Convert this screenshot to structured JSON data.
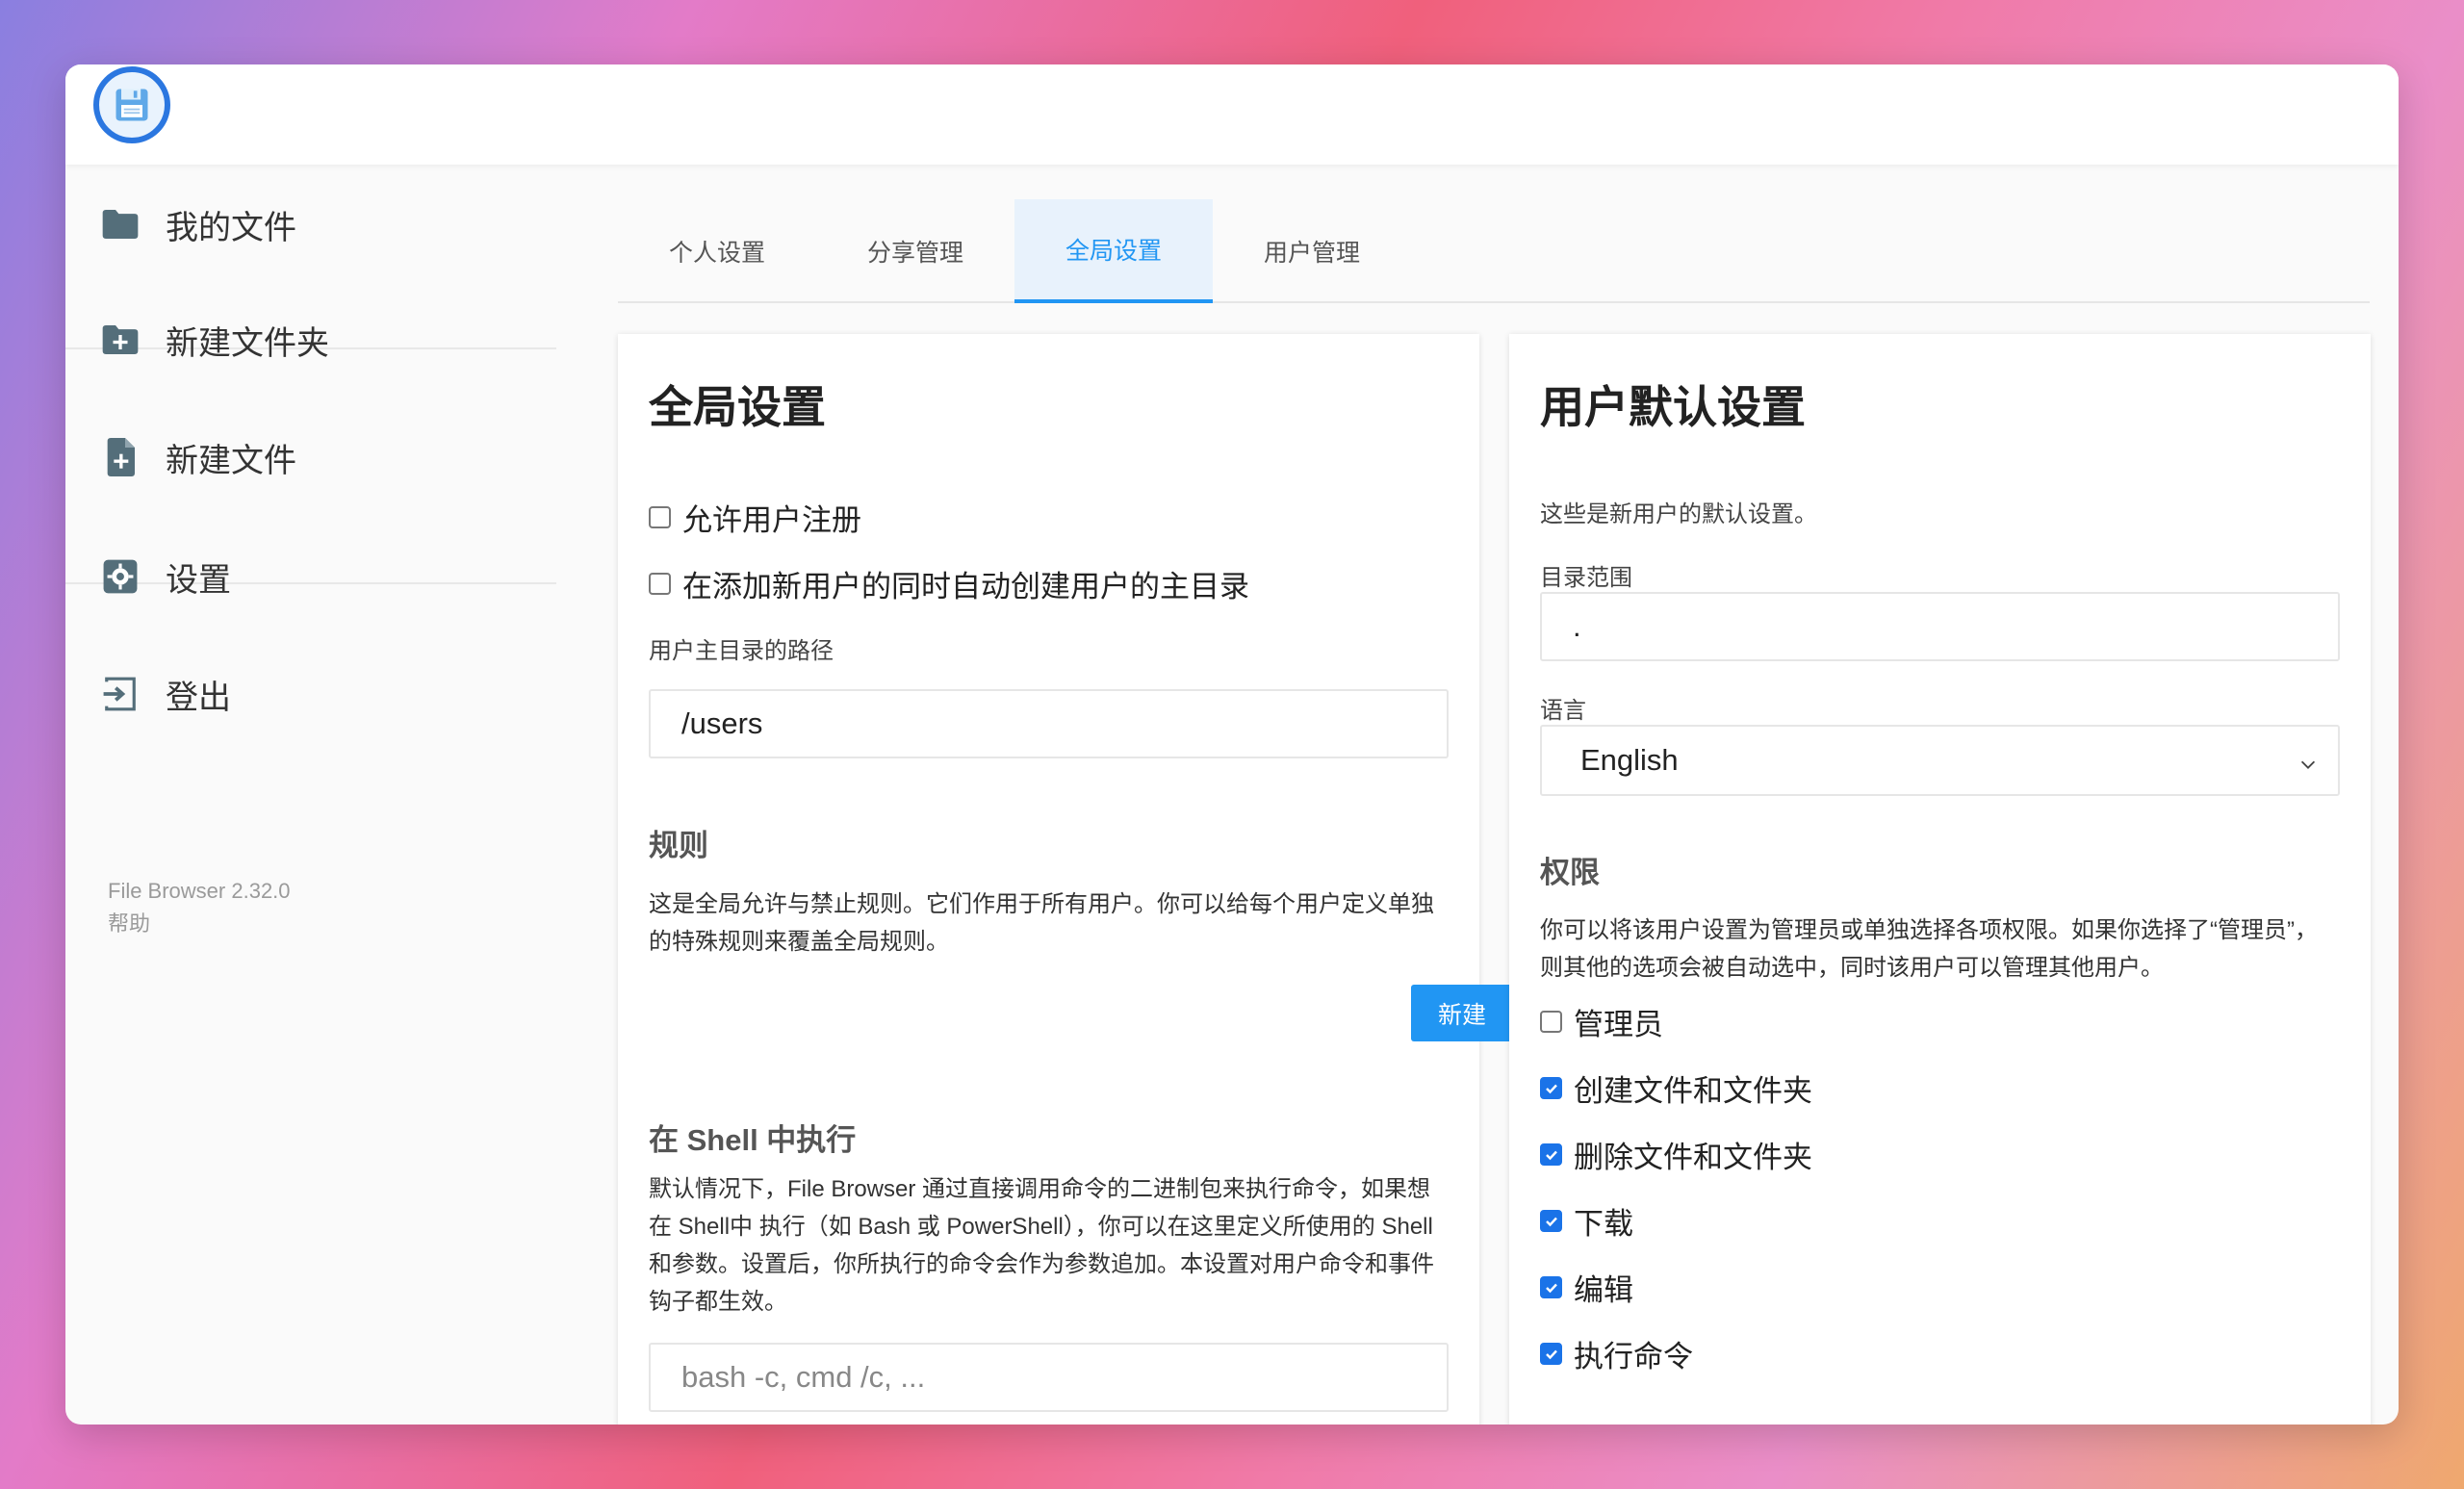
{
  "sidebar": {
    "items": [
      {
        "label": "我的文件",
        "icon": "folder-icon"
      },
      {
        "label": "新建文件夹",
        "icon": "folder-plus-icon"
      },
      {
        "label": "新建文件",
        "icon": "file-plus-icon"
      },
      {
        "label": "设置",
        "icon": "gear-icon"
      },
      {
        "label": "登出",
        "icon": "logout-icon"
      }
    ],
    "version": "File Browser 2.32.0",
    "help": "帮助"
  },
  "tabs": [
    {
      "label": "个人设置",
      "active": false
    },
    {
      "label": "分享管理",
      "active": false
    },
    {
      "label": "全局设置",
      "active": true
    },
    {
      "label": "用户管理",
      "active": false
    }
  ],
  "global": {
    "title": "全局设置",
    "allow_signup": {
      "label": "允许用户注册",
      "checked": false
    },
    "create_home": {
      "label": "在添加新用户的同时自动创建用户的主目录",
      "checked": false
    },
    "home_path_label": "用户主目录的路径",
    "home_path_value": "/users",
    "rules_title": "规则",
    "rules_desc": "这是全局允许与禁止规则。它们作用于所有用户。你可以给每个用户定义单独的特殊规则来覆盖全局规则。",
    "new_button": "新建",
    "shell_title": "在 Shell 中执行",
    "shell_desc": "默认情况下，File Browser 通过直接调用命令的二进制包来执行命令，如果想在 Shell中 执行（如 Bash 或 PowerShell），你可以在这里定义所使用的 Shell 和参数。设置后，你所执行的命令会作为参数追加。本设置对用户命令和事件钩子都生效。",
    "shell_placeholder": "bash -c, cmd /c, ..."
  },
  "defaults": {
    "title": "用户默认设置",
    "desc": "这些是新用户的默认设置。",
    "scope_label": "目录范围",
    "scope_value": ".",
    "language_label": "语言",
    "language_value": "English",
    "perm_title": "权限",
    "perm_desc": "你可以将该用户设置为管理员或单独选择各项权限。如果你选择了“管理员”，则其他的选项会被自动选中，同时该用户可以管理其他用户。",
    "permissions": [
      {
        "label": "管理员",
        "checked": false
      },
      {
        "label": "创建文件和文件夹",
        "checked": true
      },
      {
        "label": "删除文件和文件夹",
        "checked": true
      },
      {
        "label": "下载",
        "checked": true
      },
      {
        "label": "编辑",
        "checked": true
      },
      {
        "label": "执行命令",
        "checked": true
      }
    ]
  },
  "colors": {
    "accent": "#2196f3",
    "checkbox": "#1a73e8",
    "logo_ring": "#2b77e0"
  }
}
